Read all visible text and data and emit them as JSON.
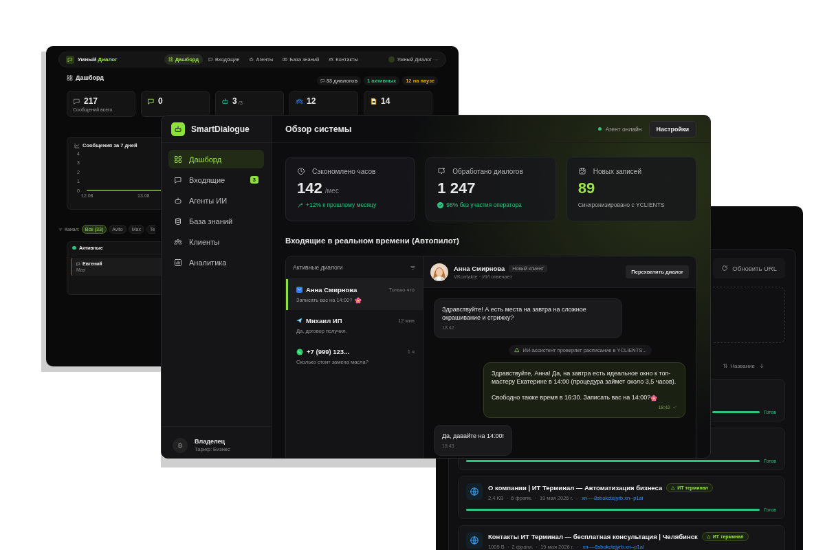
{
  "back_window": {
    "brand": {
      "first": "Умный",
      "second": "Диалог"
    },
    "nav": [
      {
        "label": "Дашборд",
        "selected": true
      },
      {
        "label": "Входящие",
        "selected": false
      },
      {
        "label": "Агенты",
        "selected": false
      },
      {
        "label": "База знаний",
        "selected": false
      },
      {
        "label": "Контакты",
        "selected": false
      }
    ],
    "user": "Умный Диалог",
    "title": "Дашборд",
    "badges": [
      {
        "label": "33 диалогов",
        "color": "#a8a8a8"
      },
      {
        "label": "1 активных",
        "color": "#2ec27e"
      },
      {
        "label": "12 на паузе",
        "color": "#e5a50a"
      }
    ],
    "stats": [
      {
        "value": "217",
        "label": "Сообщений всего"
      },
      {
        "value": "0"
      },
      {
        "value": "3",
        "suffix": "/3"
      },
      {
        "value": "12"
      },
      {
        "value": "14"
      }
    ],
    "chart": {
      "title": "Сообщения за 7 дней",
      "y_labels": [
        "4",
        "3",
        "2",
        "1",
        "0"
      ],
      "x_labels": [
        "12.08",
        "13.08"
      ]
    },
    "filter": {
      "label": "Канал:",
      "chips": [
        {
          "label": "Все (33)",
          "selected": true
        },
        {
          "label": "Avito",
          "selected": false
        },
        {
          "label": "Max",
          "selected": false
        },
        {
          "label": "Te",
          "selected": false
        }
      ]
    },
    "active": {
      "title": "Активные",
      "items": [
        {
          "name": "Евгений",
          "channel": "Max"
        }
      ]
    }
  },
  "main_window": {
    "brand": "SmartDialogue",
    "sidebar": [
      {
        "label": "Дашборд",
        "selected": true
      },
      {
        "label": "Входящие",
        "selected": false,
        "badge": "3"
      },
      {
        "label": "Агенты ИИ",
        "selected": false
      },
      {
        "label": "База знаний",
        "selected": false
      },
      {
        "label": "Клиенты",
        "selected": false
      },
      {
        "label": "Аналитика",
        "selected": false
      }
    ],
    "owner": {
      "initial": "В",
      "name": "Владелец",
      "plan": "Тариф: Бизнес"
    },
    "title": "Обзор системы",
    "status": "Агент онлайн",
    "settings_button": "Настройки",
    "stats": [
      {
        "label": "Сэкономлено часов",
        "value": "142",
        "unit": "/мес",
        "note": "+12% к прошлому месяцу"
      },
      {
        "label": "Обработано диалогов",
        "value": "1 247",
        "note": "98% без участия оператора"
      },
      {
        "label": "Новых записей",
        "value": "89",
        "note": "Синхронизировано с YCLIENTS"
      }
    ],
    "section_title": "Входящие в реальном времени (Автопилот)",
    "inbox": {
      "title": "Активные диалоги",
      "dialogs": [
        {
          "name": "Анна Смирнова",
          "time": "Только что",
          "preview": "Записать вас на 14:00?",
          "flower": true,
          "selected": true
        },
        {
          "name": "Михаил ИП",
          "time": "12 мин",
          "preview": "Да, договор получил.",
          "selected": false
        },
        {
          "name": "+7 (999) 123...",
          "time": "1 ч",
          "preview": "Сколько стоит замена масла?",
          "selected": false
        }
      ]
    },
    "chat": {
      "contact": {
        "name": "Анна Смирнова",
        "tag": "Новый клиент",
        "sub": "VKontakte · ИИ отвечает"
      },
      "takeover_button": "Перехватить диалог",
      "messages": [
        {
          "kind": "incoming",
          "paragraphs": [
            "Здравствуйте! А есть места на завтра на сложное окрашивание и стрижку?"
          ],
          "time": "18:42"
        },
        {
          "kind": "system",
          "paragraphs": [
            "ИИ-ассистент проверяет расписание в YCLIENTS..."
          ]
        },
        {
          "kind": "outgoing",
          "paragraphs": [
            "Здравствуйте, Анна! Да, на завтра есть идеальное окно к топ-мастеру Екатерине в 14:00 (процедура займет около 3,5 часов).",
            "Свободно также время в 16:30. Записать вас на 14:00?"
          ],
          "flower": true,
          "time": "18:42",
          "read": true
        },
        {
          "kind": "incoming",
          "paragraphs": [
            "Да, давайте на 14:00!"
          ],
          "time": "18:43"
        }
      ]
    }
  },
  "right_window": {
    "refresh_button": "Обновить URL",
    "sort": {
      "label": "Название"
    },
    "docs": [
      {
        "status": "Готов",
        "level": 1
      },
      {
        "status": "Готов",
        "level": 1
      },
      {
        "title": "О компании | ИТ Терминал — Автоматизация бизнеса",
        "tag": "ИТ терминал",
        "meta": "2,4 KB  ·  6 фрагм.  ·  19 мая 2026 г.  ·",
        "link": "xn----8sbokctejyrb.xn--p1ai",
        "status": "Готов",
        "level": 1
      },
      {
        "title": "Контакты ИТ Терминал — бесплатная консультация | Челябинск",
        "tag": "ИТ терминал",
        "meta": "1005 B  ·  2 фрагм.  ·  19 мая 2026 г.  ·",
        "link": "xn----8sbokctejyrb.xn--p1ai"
      }
    ]
  }
}
